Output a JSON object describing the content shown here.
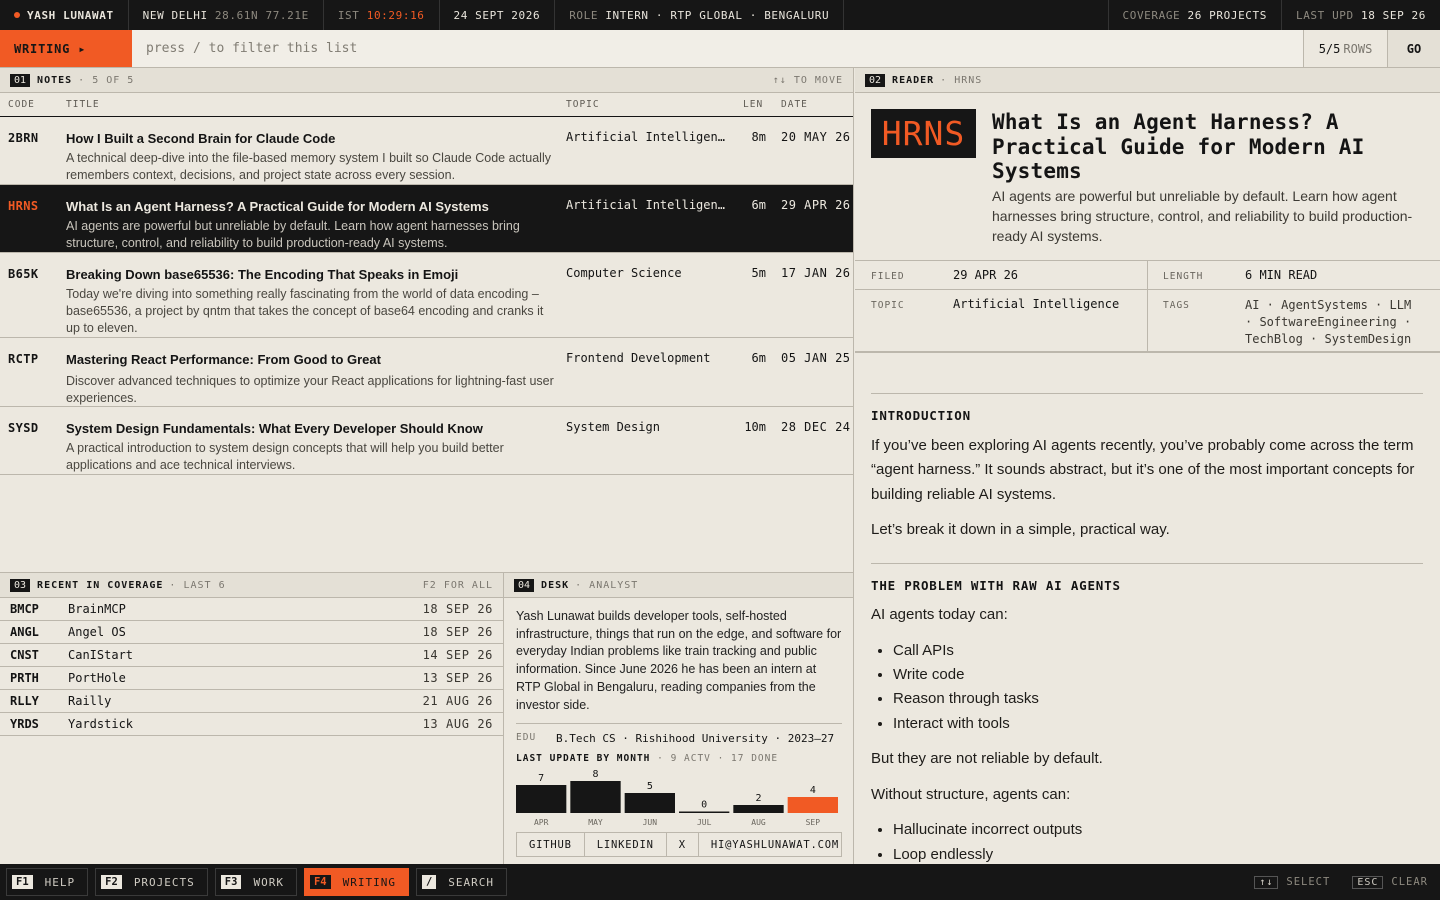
{
  "topbar": {
    "name": "YASH LUNAWAT",
    "city": "NEW DELHI",
    "coords": "28.61N 77.21E",
    "tz_label": "IST",
    "time": "10:29:16",
    "date": "24 SEPT 2026",
    "role_label": "ROLE",
    "role_value": "INTERN · RTP GLOBAL · BENGALURU",
    "coverage_label": "COVERAGE",
    "coverage_value": "26 PROJECTS",
    "upd_label": "LAST UPD",
    "upd_value": "18 SEP 26"
  },
  "cmdbar": {
    "mode": "WRITING ▸",
    "placeholder": "press / to filter this list",
    "rows_count": "5/5",
    "rows_label": "ROWS",
    "go": "GO"
  },
  "notes": {
    "num": "01",
    "title": "NOTES",
    "subtitle": "· 5 OF 5",
    "hint": "↑↓ TO MOVE",
    "columns": {
      "code": "CODE",
      "title": "TITLE",
      "topic": "TOPIC",
      "len": "LEN",
      "date": "DATE"
    },
    "rows": [
      {
        "code": "2BRN",
        "title": "How I Built a Second Brain for Claude Code",
        "desc": "A technical deep-dive into the file-based memory system I built so Claude Code actually remembers context, decisions, and project state across every session.",
        "topic": "Artificial Intelligence",
        "len": "8m",
        "date": "20 MAY 26"
      },
      {
        "code": "HRNS",
        "title": "What Is an Agent Harness? A Practical Guide for Modern AI Systems",
        "desc": "AI agents are powerful but unreliable by default. Learn how agent harnesses bring structure, control, and reliability to build production-ready AI systems.",
        "topic": "Artificial Intelligence",
        "len": "6m",
        "date": "29 APR 26"
      },
      {
        "code": "B65K",
        "title": "Breaking Down base65536: The Encoding That Speaks in Emoji",
        "desc": "Today we're diving into something really fascinating from the world of data encoding – base65536, a project by qntm that takes the concept of base64 encoding and cranks it up to eleven.",
        "topic": "Computer Science",
        "len": "5m",
        "date": "17 JAN 26"
      },
      {
        "code": "RCTP",
        "title": "Mastering React Performance: From Good to Great",
        "desc": "Discover advanced techniques to optimize your React applications for lightning-fast user experiences.",
        "topic": "Frontend Development",
        "len": "6m",
        "date": "05 JAN 25"
      },
      {
        "code": "SYSD",
        "title": "System Design Fundamentals: What Every Developer Should Know",
        "desc": "A practical introduction to system design concepts that will help you build better applications and ace technical interviews.",
        "topic": "System Design",
        "len": "10m",
        "date": "28 DEC 24"
      }
    ]
  },
  "recent": {
    "num": "03",
    "title": "RECENT IN COVERAGE",
    "subtitle": "· LAST 6",
    "hint": "F2 FOR ALL",
    "rows": [
      {
        "code": "BMCP",
        "name": "BrainMCP",
        "date": "18 SEP 26"
      },
      {
        "code": "ANGL",
        "name": "Angel OS",
        "date": "18 SEP 26"
      },
      {
        "code": "CNST",
        "name": "CanIStart",
        "date": "14 SEP 26"
      },
      {
        "code": "PRTH",
        "name": "PortHole",
        "date": "13 SEP 26"
      },
      {
        "code": "RLLY",
        "name": "Railly",
        "date": "21 AUG 26"
      },
      {
        "code": "YRDS",
        "name": "Yardstick",
        "date": "13 AUG 26"
      }
    ]
  },
  "desk": {
    "num": "04",
    "title": "DESK",
    "subtitle": "· ANALYST",
    "bio": "Yash Lunawat builds developer tools, self-hosted infrastructure, things that run on the edge, and software for everyday Indian problems like train tracking and public information. Since June 2026 he has been an intern at RTP Global in Bengaluru, reading companies from the investor side.",
    "edu_label": "EDU",
    "edu_value": "B.Tech CS · Rishihood University · 2023–27",
    "chart_title": "LAST UPDATE BY MONTH",
    "chart_sub": "· 9 ACTV · 17 DONE",
    "links": [
      "GITHUB",
      "LINKEDIN",
      "X",
      "HI@YASHLUNAWAT.COM"
    ]
  },
  "chart_data": {
    "type": "bar",
    "title": "LAST UPDATE BY MONTH",
    "categories": [
      "APR",
      "MAY",
      "JUN",
      "JUL",
      "AUG",
      "SEP"
    ],
    "values": [
      7,
      8,
      5,
      0,
      2,
      4
    ],
    "highlight_color": "#f15a24",
    "bar_color": "#161616"
  },
  "reader": {
    "num": "02",
    "title": "READER",
    "subtitle": "· HRNS",
    "badge": "HRNS",
    "article_title": "What Is an Agent Harness? A Practical Guide for Modern AI Systems",
    "article_desc": "AI agents are powerful but unreliable by default. Learn how agent harnesses bring structure, control, and reliability to build production-ready AI systems.",
    "meta": {
      "filed_label": "FILED",
      "filed_value": "29 APR 26",
      "length_label": "LENGTH",
      "length_value": "6 MIN READ",
      "topic_label": "TOPIC",
      "topic_value": "Artificial Intelligence",
      "tags_label": "TAGS",
      "tags_value": "AI · AgentSystems · LLM · SoftwareEngineering · TechBlog · SystemDesign"
    },
    "body": {
      "h1": "INTRODUCTION",
      "p1": "If you’ve been exploring AI agents recently, you’ve probably come across the term “agent harness.” It sounds abstract, but it’s one of the most important concepts for building reliable AI systems.",
      "p2": "Let’s break it down in a simple, practical way.",
      "h2": "THE PROBLEM WITH RAW AI AGENTS",
      "p3": "AI agents today can:",
      "list1": [
        "Call APIs",
        "Write code",
        "Reason through tasks",
        "Interact with tools"
      ],
      "p4": "But they are not reliable by default.",
      "p5": "Without structure, agents can:",
      "list2": [
        "Hallucinate incorrect outputs",
        "Loop endlessly"
      ]
    }
  },
  "bottombar": {
    "keys": [
      {
        "key": "F1",
        "label": "HELP"
      },
      {
        "key": "F2",
        "label": "PROJECTS"
      },
      {
        "key": "F3",
        "label": "WORK"
      },
      {
        "key": "F4",
        "label": "WRITING"
      },
      {
        "key": "/",
        "label": "SEARCH"
      }
    ],
    "select_key": "↑↓",
    "select_label": "SELECT",
    "clear_key": "ESC",
    "clear_label": "CLEAR"
  }
}
